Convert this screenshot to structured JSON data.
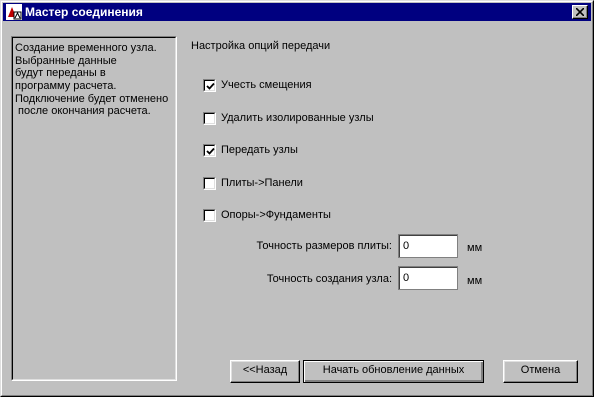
{
  "window": {
    "title": "Мастер соединения",
    "icon": "app-logo-icon",
    "close_icon": "close-icon"
  },
  "info_panel": {
    "lines": [
      "Создание временного узла.",
      "Выбранные данные",
      "будут переданы в",
      "программу расчета.",
      "Подключение будет отменено",
      " после окончания расчета."
    ]
  },
  "options": {
    "section_title": "Настройка опций передачи",
    "items": [
      {
        "label": "Учесть смещения",
        "checked": true
      },
      {
        "label": "Удалить изолированные узлы",
        "checked": false
      },
      {
        "label": "Передать узлы",
        "checked": true
      },
      {
        "label": "Плиты->Панели",
        "checked": false
      },
      {
        "label": "Опоры->Фундаменты",
        "checked": false
      }
    ]
  },
  "fields": {
    "plate_precision": {
      "label": "Точность размеров плиты:",
      "value": "0",
      "unit": "мм"
    },
    "node_precision": {
      "label": "Точность создания узла:",
      "value": "0",
      "unit": "мм"
    }
  },
  "buttons": {
    "back": "<<Назад",
    "start": "Начать обновление данных",
    "cancel": "Отмена"
  }
}
